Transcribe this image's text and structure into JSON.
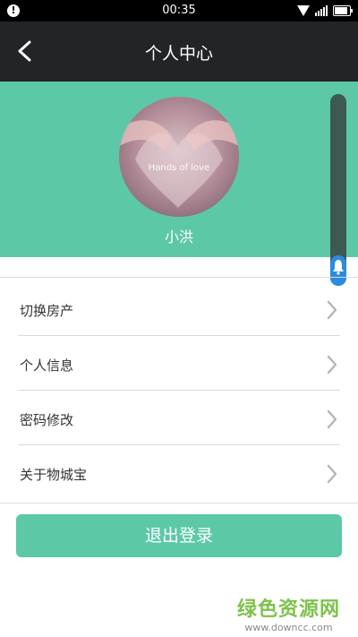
{
  "status_bar": {
    "time": "00:35",
    "left_icon": "!",
    "battery_fraction": 0.9
  },
  "header": {
    "title": "个人中心"
  },
  "profile": {
    "username": "小洪",
    "avatar_text": "Hands of love"
  },
  "menu": {
    "items": [
      {
        "label": "切换房产"
      },
      {
        "label": "个人信息"
      },
      {
        "label": "密码修改"
      },
      {
        "label": "关于物城宝"
      }
    ]
  },
  "logout_label": "退出登录",
  "watermark": {
    "main": "绿色资源网",
    "sub": "www.downcc.com"
  },
  "colors": {
    "accent": "#5cc8a8",
    "header_bg": "#222426",
    "status_bg": "#000000",
    "scroll_thumb": "#2a8be0"
  }
}
